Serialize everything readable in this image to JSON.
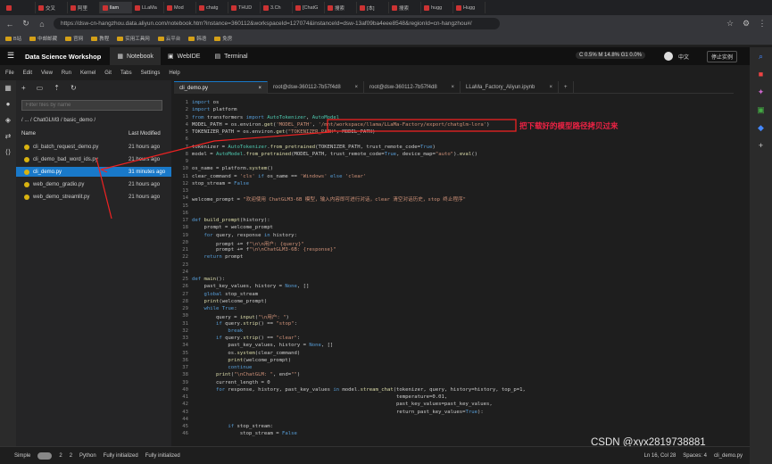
{
  "browser": {
    "tabs": [
      "",
      "交叉",
      "阿里",
      "llam",
      "LLaMa",
      "Mod",
      "chatg",
      "THUD",
      "3.Ch",
      "[ChatG",
      "搜索",
      "[本]",
      "搜索",
      "hugg",
      "Hugg"
    ],
    "url": "https://dsw-cn-hangzhou.data.aliyun.com/notebook.htm?instance=360112&workspaceId=127074&instanceId=dsw-13af09ba4eee8548&regionId=cn-hangzhou#/",
    "bookmarks": [
      "B站",
      "中邮邮藏",
      "官网",
      "教程",
      "实用工具网",
      "云平台",
      "韩语",
      "免房"
    ]
  },
  "app": {
    "title": "Data Science Workshop",
    "tabs": [
      "Notebook",
      "WebIDE",
      "Terminal"
    ],
    "resource": "C 0.5%  M 14.8%  G1 0.0%",
    "lang": "中文",
    "stop_button": "停止实例"
  },
  "menu": [
    "File",
    "Edit",
    "View",
    "Run",
    "Kernel",
    "Git",
    "Tabs",
    "Settings",
    "Help"
  ],
  "filebrowser": {
    "filter_placeholder": "Filter files by name",
    "breadcrumb": "/ ... / ChatGLM3 / basic_demo /",
    "col_name": "Name",
    "col_modified": "Last Modified",
    "files": [
      {
        "name": "cli_batch_request_demo.py",
        "time": "21 hours ago"
      },
      {
        "name": "cli_demo_bad_word_ids.py",
        "time": "21 hours ago"
      },
      {
        "name": "cli_demo.py",
        "time": "31 minutes ago"
      },
      {
        "name": "web_demo_gradio.py",
        "time": "21 hours ago"
      },
      {
        "name": "web_demo_streamlit.py",
        "time": "21 hours ago"
      }
    ]
  },
  "editor_tabs": [
    "cli_demo.py",
    "root@dsw-360112-7b57f4d8",
    "root@dsw-360112-7b57f4d8",
    "LLaMa_Factory_Aliyun.ipynb"
  ],
  "annotation": "把下载好的模型路径拷贝过来",
  "watermark": "CSDN @xyx2819738881",
  "status": {
    "mode": "Simple",
    "kernels": "2",
    "terminals": "2",
    "python": "Python",
    "init1": "Fully initialized",
    "init2": "Fully initialized",
    "cursor": "Ln 16, Col 28",
    "spaces": "Spaces: 4",
    "file": "cli_demo.py"
  },
  "code_lines": [
    "import os",
    "import platform",
    "from transformers import AutoTokenizer, AutoModel",
    "MODEL_PATH = os.environ.get('MODEL_PATH', '/mnt/workspace/llama/LLaMa-Factory/export/chatglm-lora')",
    "TOKENIZER_PATH = os.environ.get(\"TOKENIZER_PATH\", MODEL_PATH)",
    "",
    "tokenizer = AutoTokenizer.from_pretrained(TOKENIZER_PATH, trust_remote_code=True)",
    "model = AutoModel.from_pretrained(MODEL_PATH, trust_remote_code=True, device_map=\"auto\").eval()",
    "",
    "os_name = platform.system()",
    "clear_command = 'cls' if os_name == 'Windows' else 'clear'",
    "stop_stream = False",
    "",
    "welcome_prompt = \"欢迎使用 ChatGLM3-6B 模型，输入内容即可进行对话，clear 清空对话历史，stop 终止程序\"",
    "",
    "",
    "def build_prompt(history):",
    "    prompt = welcome_prompt",
    "    for query, response in history:",
    "        prompt += f\"\\n\\n用户: {query}\"",
    "        prompt += f\"\\n\\nChatGLM3-6B: {response}\"",
    "    return prompt",
    "",
    "",
    "def main():",
    "    past_key_values, history = None, []",
    "    global stop_stream",
    "    print(welcome_prompt)",
    "    while True:",
    "        query = input(\"\\n用户: \")",
    "        if query.strip() == \"stop\":",
    "            break",
    "        if query.strip() == \"clear\":",
    "            past_key_values, history = None, []",
    "            os.system(clear_command)",
    "            print(welcome_prompt)",
    "            continue",
    "        print(\"\\nChatGLM: \", end=\"\")",
    "        current_length = 0",
    "        for response, history, past_key_values in model.stream_chat(tokenizer, query, history=history, top_p=1,",
    "                                                                    temperature=0.01,",
    "                                                                    past_key_values=past_key_values,",
    "                                                                    return_past_key_values=True):",
    "",
    "            if stop_stream:",
    "                stop_stream = False"
  ]
}
